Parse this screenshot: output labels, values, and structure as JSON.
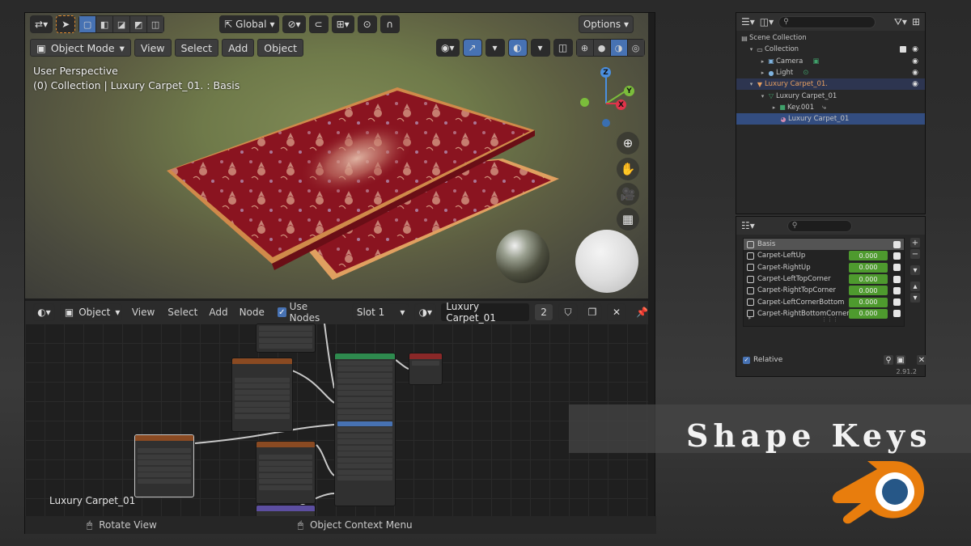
{
  "viewport": {
    "toolbar": {
      "transform_orientation": "Global",
      "options_label": "Options"
    },
    "mode_label": "Object Mode",
    "menus": [
      "View",
      "Select",
      "Add",
      "Object"
    ],
    "info_line1": "User Perspective",
    "info_line2": "(0) Collection | Luxury Carpet_01. : Basis",
    "gizmo": {
      "z": "Z",
      "y": "Y",
      "x": "X"
    }
  },
  "node_editor": {
    "type_label": "Object",
    "menus": [
      "View",
      "Select",
      "Add",
      "Node"
    ],
    "use_nodes_label": "Use Nodes",
    "slot_label": "Slot 1",
    "material_name": "Luxury Carpet_01",
    "user_count": "2",
    "object_label": "Luxury Carpet_01"
  },
  "status_bar": {
    "left_hint": "Rotate View",
    "right_hint": "Object Context Menu"
  },
  "outliner": {
    "rows": [
      {
        "label": "Scene Collection"
      },
      {
        "label": "Collection"
      },
      {
        "label": "Camera"
      },
      {
        "label": "Light"
      },
      {
        "label": "Luxury Carpet_01."
      },
      {
        "label": "Luxury Carpet_01"
      },
      {
        "label": "Key.001"
      },
      {
        "label": "Luxury Carpet_01"
      }
    ]
  },
  "shape_keys": {
    "items": [
      {
        "name": "Basis",
        "value": ""
      },
      {
        "name": "Carpet-LeftUp",
        "value": "0.000"
      },
      {
        "name": "Carpet-RightUp",
        "value": "0.000"
      },
      {
        "name": "Carpet-LeftTopCorner",
        "value": "0.000"
      },
      {
        "name": "Carpet-RightTopCorner",
        "value": "0.000"
      },
      {
        "name": "Carpet-LeftCornerBottom",
        "value": "0.000"
      },
      {
        "name": "Carpet-RightBottomCorner",
        "value": "0.000"
      }
    ],
    "relative_label": "Relative",
    "version": "2.91.2"
  },
  "banner": {
    "title": "Shape Keys"
  },
  "colors": {
    "accent": "#4772b3",
    "value_green": "#4e9a2e",
    "carpet_red": "#8e1420",
    "blender_orange": "#e87d0d",
    "blender_blue": "#265787"
  }
}
